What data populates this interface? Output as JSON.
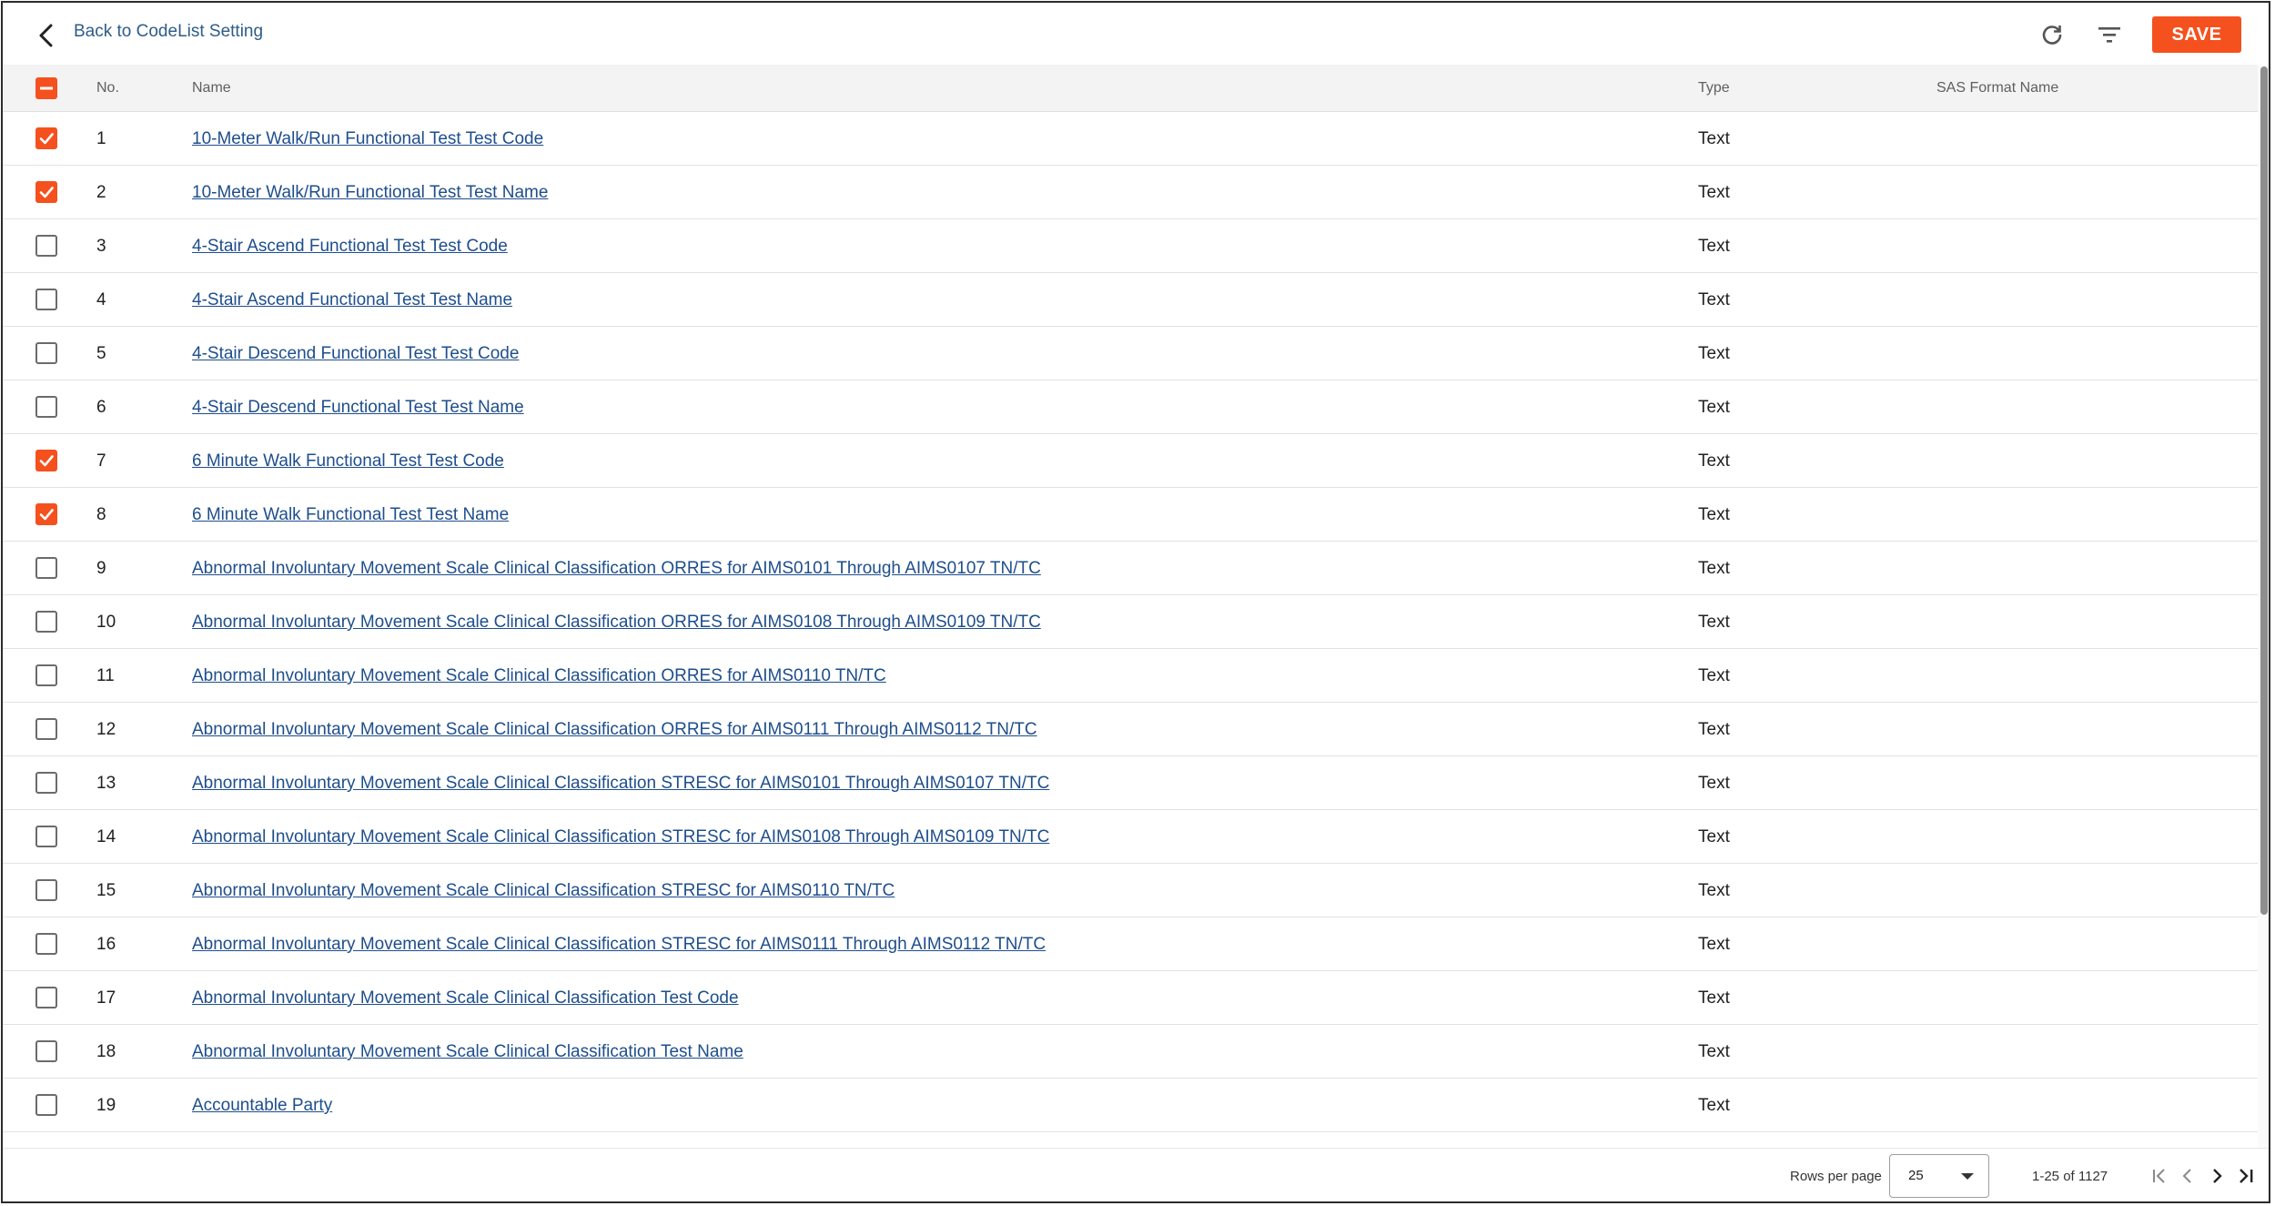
{
  "header": {
    "back_label": "Back to CodeList Setting",
    "save_label": "SAVE",
    "refresh_icon": "refresh-icon",
    "filter_icon": "filter-icon"
  },
  "colors": {
    "accent": "#f4511e",
    "link": "#1e4e8c",
    "header_bg": "#f3f3f3"
  },
  "table": {
    "columns": {
      "no": "No.",
      "name": "Name",
      "type": "Type",
      "sas": "SAS Format Name"
    },
    "header_checkbox": "indeterminate",
    "rows": [
      {
        "no": "1",
        "name": "10-Meter Walk/Run Functional Test Test Code",
        "type": "Text",
        "checked": true
      },
      {
        "no": "2",
        "name": "10-Meter Walk/Run Functional Test Test Name",
        "type": "Text",
        "checked": true
      },
      {
        "no": "3",
        "name": "4-Stair Ascend Functional Test Test Code",
        "type": "Text",
        "checked": false
      },
      {
        "no": "4",
        "name": "4-Stair Ascend Functional Test Test Name",
        "type": "Text",
        "checked": false
      },
      {
        "no": "5",
        "name": "4-Stair Descend Functional Test Test Code",
        "type": "Text",
        "checked": false
      },
      {
        "no": "6",
        "name": "4-Stair Descend Functional Test Test Name",
        "type": "Text",
        "checked": false
      },
      {
        "no": "7",
        "name": "6 Minute Walk Functional Test Test Code",
        "type": "Text",
        "checked": true
      },
      {
        "no": "8",
        "name": "6 Minute Walk Functional Test Test Name",
        "type": "Text",
        "checked": true
      },
      {
        "no": "9",
        "name": "Abnormal Involuntary Movement Scale Clinical Classification ORRES for AIMS0101 Through AIMS0107 TN/TC",
        "type": "Text",
        "checked": false
      },
      {
        "no": "10",
        "name": "Abnormal Involuntary Movement Scale Clinical Classification ORRES for AIMS0108 Through AIMS0109 TN/TC",
        "type": "Text",
        "checked": false
      },
      {
        "no": "11",
        "name": "Abnormal Involuntary Movement Scale Clinical Classification ORRES for AIMS0110 TN/TC",
        "type": "Text",
        "checked": false
      },
      {
        "no": "12",
        "name": "Abnormal Involuntary Movement Scale Clinical Classification ORRES for AIMS0111 Through AIMS0112 TN/TC",
        "type": "Text",
        "checked": false
      },
      {
        "no": "13",
        "name": "Abnormal Involuntary Movement Scale Clinical Classification STRESC for AIMS0101 Through AIMS0107 TN/TC",
        "type": "Text",
        "checked": false
      },
      {
        "no": "14",
        "name": "Abnormal Involuntary Movement Scale Clinical Classification STRESC for AIMS0108 Through AIMS0109 TN/TC",
        "type": "Text",
        "checked": false
      },
      {
        "no": "15",
        "name": "Abnormal Involuntary Movement Scale Clinical Classification STRESC for AIMS0110 TN/TC",
        "type": "Text",
        "checked": false
      },
      {
        "no": "16",
        "name": "Abnormal Involuntary Movement Scale Clinical Classification STRESC for AIMS0111 Through AIMS0112 TN/TC",
        "type": "Text",
        "checked": false
      },
      {
        "no": "17",
        "name": "Abnormal Involuntary Movement Scale Clinical Classification Test Code",
        "type": "Text",
        "checked": false
      },
      {
        "no": "18",
        "name": "Abnormal Involuntary Movement Scale Clinical Classification Test Name",
        "type": "Text",
        "checked": false
      },
      {
        "no": "19",
        "name": "Accountable Party",
        "type": "Text",
        "checked": false
      },
      {
        "no": "",
        "name": "",
        "type": "",
        "checked": false
      }
    ]
  },
  "footer": {
    "rows_per_page_label": "Rows per page",
    "rows_per_page_value": "25",
    "range_text": "1-25 of 1127"
  }
}
